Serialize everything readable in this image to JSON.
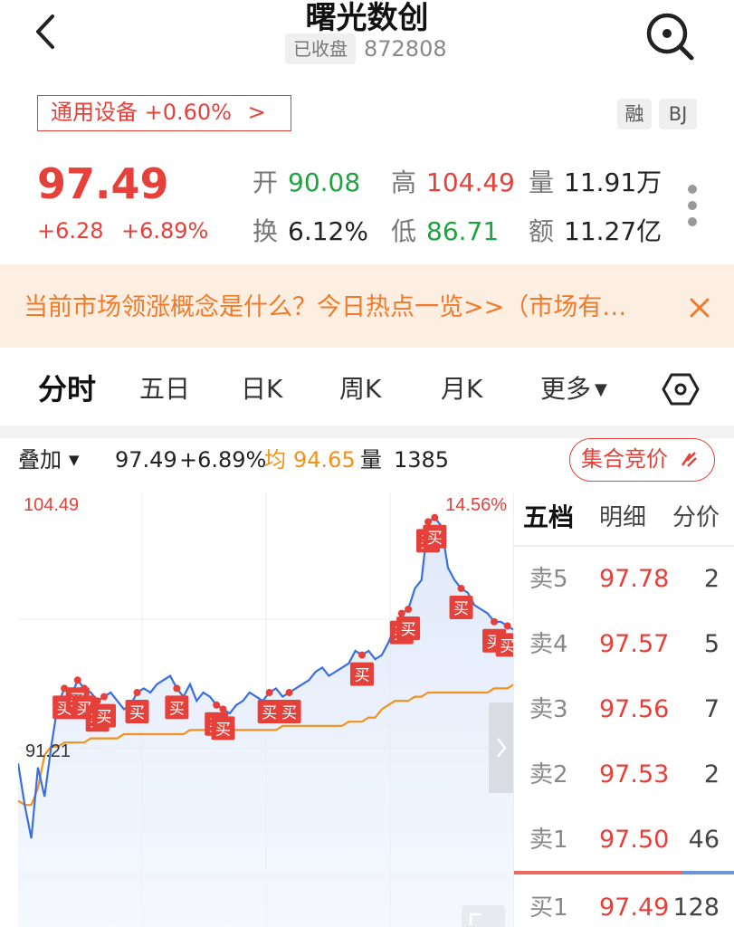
{
  "header": {
    "title": "曙光数创",
    "status": "已收盘",
    "code": "872808"
  },
  "sector": {
    "label": "通用设备 +0.60%",
    "arrow": ">"
  },
  "tags": [
    "融",
    "BJ"
  ],
  "quote": {
    "price": "97.49",
    "change": "+6.28",
    "change_pct": "+6.89%",
    "open_label": "开",
    "open": "90.08",
    "high_label": "高",
    "high": "104.49",
    "vol_label": "量",
    "vol": "11.91万",
    "turnover_label": "换",
    "turnover": "6.12%",
    "low_label": "低",
    "low": "86.71",
    "amount_label": "额",
    "amount": "11.27亿"
  },
  "banner": {
    "text": "当前市场领涨概念是什么？今日热点一览>>（市场有…"
  },
  "tabs": [
    "分时",
    "五日",
    "日K",
    "周K",
    "月K",
    "更多"
  ],
  "overlay": {
    "label": "叠加",
    "price": "97.49",
    "pct": "+6.89%",
    "avg_label": "均",
    "avg": "94.65",
    "vol_label": "量",
    "vol": "1385",
    "auction": "集合竞价"
  },
  "chart_data": {
    "type": "line",
    "high_label": "104.49",
    "high_pct_label": "14.56%",
    "ref_label": "91.21",
    "buy_marker_text": "买",
    "series": [
      {
        "values": [
          0.62,
          0.72,
          0.8,
          0.63,
          0.7,
          0.58,
          0.48,
          0.44,
          0.46,
          0.42,
          0.44,
          0.45,
          0.47,
          0.46,
          0.45,
          0.47,
          0.49,
          0.48,
          0.45,
          0.44,
          0.45,
          0.43,
          0.42,
          0.41,
          0.44,
          0.46,
          0.43,
          0.47,
          0.45,
          0.46,
          0.48,
          0.49,
          0.5,
          0.48,
          0.47,
          0.45,
          0.46,
          0.47,
          0.45,
          0.44,
          0.46,
          0.45,
          0.44,
          0.43,
          0.42,
          0.4,
          0.39,
          0.41,
          0.4,
          0.39,
          0.38,
          0.35,
          0.36,
          0.35,
          0.37,
          0.36,
          0.33,
          0.29,
          0.26,
          0.25,
          0.2,
          0.18,
          0.04,
          0.03,
          0.05,
          0.15,
          0.18,
          0.2,
          0.21,
          0.24,
          0.25,
          0.26,
          0.28,
          0.28,
          0.29,
          0.3
        ]
      },
      {
        "values": [
          0.71,
          0.72,
          0.72,
          0.68,
          0.6,
          0.58,
          0.58,
          0.57,
          0.57,
          0.57,
          0.57,
          0.56,
          0.56,
          0.56,
          0.56,
          0.56,
          0.55,
          0.55,
          0.55,
          0.55,
          0.55,
          0.55,
          0.55,
          0.55,
          0.55,
          0.55,
          0.54,
          0.54,
          0.54,
          0.54,
          0.54,
          0.54,
          0.54,
          0.54,
          0.54,
          0.54,
          0.54,
          0.54,
          0.54,
          0.54,
          0.53,
          0.53,
          0.53,
          0.53,
          0.53,
          0.53,
          0.53,
          0.53,
          0.53,
          0.53,
          0.52,
          0.52,
          0.52,
          0.51,
          0.51,
          0.49,
          0.48,
          0.47,
          0.47,
          0.47,
          0.46,
          0.46,
          0.45,
          0.45,
          0.45,
          0.45,
          0.45,
          0.45,
          0.45,
          0.45,
          0.45,
          0.45,
          0.44,
          0.44,
          0.44,
          0.43
        ]
      }
    ]
  },
  "orderbook": {
    "tabs": [
      "五档",
      "明细",
      "分价"
    ],
    "rows": [
      {
        "label": "卖5",
        "price": "97.78",
        "vol": "2"
      },
      {
        "label": "卖4",
        "price": "97.57",
        "vol": "5"
      },
      {
        "label": "卖3",
        "price": "97.56",
        "vol": "7"
      },
      {
        "label": "卖2",
        "price": "97.53",
        "vol": "2"
      },
      {
        "label": "卖1",
        "price": "97.50",
        "vol": "46"
      },
      {
        "label": "买1",
        "price": "97.49",
        "vol": "128"
      }
    ]
  },
  "colors": {
    "up": "#e5413a",
    "down": "#1fa33f",
    "price_line": "#3a6fe0",
    "avg_line": "#f0921e",
    "banner_bg": "#fdeee2"
  }
}
